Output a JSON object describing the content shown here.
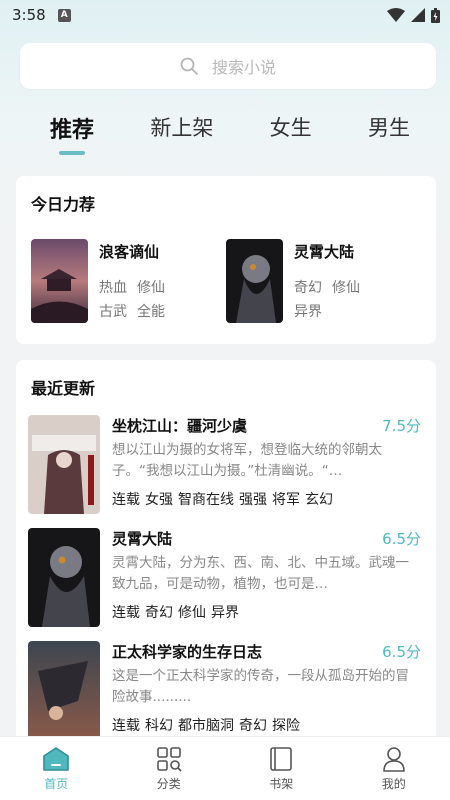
{
  "status": {
    "time": "3:58",
    "badge": "A"
  },
  "search": {
    "placeholder": "搜索小说"
  },
  "tabs": [
    {
      "label": "推荐",
      "active": true
    },
    {
      "label": "新上架"
    },
    {
      "label": "女生"
    },
    {
      "label": "男生"
    }
  ],
  "today": {
    "title": "今日力荐",
    "books": [
      {
        "name": "浪客谪仙",
        "tags_line1": [
          "热血",
          "修仙"
        ],
        "tags_line2": [
          "古武",
          "全能"
        ]
      },
      {
        "name": "灵霄大陆",
        "tags_line1": [
          "奇幻",
          "修仙"
        ],
        "tags_line2": [
          "异界"
        ]
      }
    ]
  },
  "recent": {
    "title": "最近更新",
    "books": [
      {
        "name": "坐枕江山：疆河少虞",
        "score": "7.5分",
        "desc": "想以江山为摄的女将军，想登临大统的邻朝太子。“我想以江山为摄。”杜清幽说。“…",
        "tags": [
          "连载",
          "女强",
          "智商在线",
          "强强",
          "将军",
          "玄幻"
        ]
      },
      {
        "name": "灵霄大陆",
        "score": "6.5分",
        "desc": "灵霄大陆，分为东、西、南、北、中五域。武魂一致九品，可是动物，植物，也可是…",
        "tags": [
          "连载",
          "奇幻",
          "修仙",
          "异界"
        ]
      },
      {
        "name": "正太科学家的生存日志",
        "score": "6.5分",
        "desc": "这是一个正太科学家的传奇，一段从孤岛开始的冒险故事.........",
        "tags": [
          "连载",
          "科幻",
          "都市脑洞",
          "奇幻",
          "探险"
        ]
      }
    ]
  },
  "nav": [
    {
      "label": "首页",
      "icon": "home-icon",
      "active": true
    },
    {
      "label": "分类",
      "icon": "category-icon"
    },
    {
      "label": "书架",
      "icon": "bookshelf-icon"
    },
    {
      "label": "我的",
      "icon": "profile-icon"
    }
  ],
  "colors": {
    "accent": "#4fb9be",
    "indicator": "#6bbcc4"
  }
}
